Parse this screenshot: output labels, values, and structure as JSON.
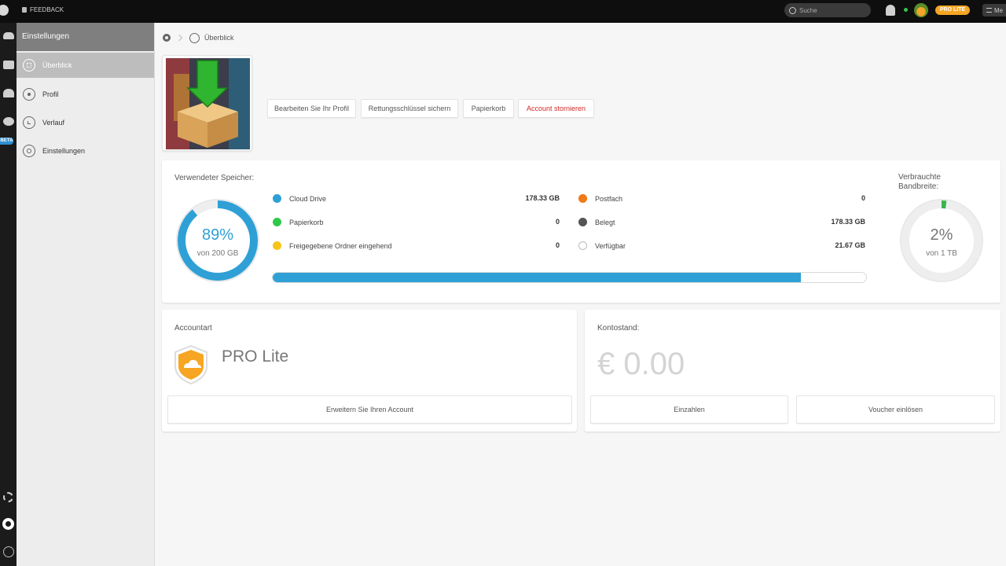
{
  "topbar": {
    "feedback_label": "FEEDBACK",
    "search_placeholder": "Suche",
    "plan_badge": "PRO LITE",
    "menu_label": "Me"
  },
  "rail": {
    "beta_badge": "BETA"
  },
  "sidebar": {
    "header": "Einstellungen",
    "items": [
      {
        "label": "Überblick",
        "icon": "grid-icon",
        "active": true
      },
      {
        "label": "Profil",
        "icon": "user-icon"
      },
      {
        "label": "Verlauf",
        "icon": "clock-icon"
      },
      {
        "label": "Einstellungen",
        "icon": "gear-icon"
      }
    ]
  },
  "breadcrumb": {
    "current": "Überblick"
  },
  "profile_actions": {
    "edit": "Bearbeiten Sie Ihr Profil",
    "backup_key": "Rettungsschlüssel sichern",
    "trash": "Papierkorb",
    "cancel_account": "Account stornieren"
  },
  "storage": {
    "title": "Verwendeter Speicher:",
    "percent_label": "89%",
    "percent_value": 89,
    "of_label": "von 200 GB",
    "bar_fill": 0.89,
    "legend": [
      {
        "label": "Cloud Drive",
        "value": "178.33 GB",
        "color": "#2ea0d6"
      },
      {
        "label": "Papierkorb",
        "value": "0",
        "color": "#2fc94a"
      },
      {
        "label": "Freigegebene Ordner eingehend",
        "value": "0",
        "color": "#f5c518"
      },
      {
        "label": "Postfach",
        "value": "0",
        "color": "#f07a16"
      },
      {
        "label": "Belegt",
        "value": "178.33 GB",
        "color": "#555555"
      },
      {
        "label": "Verfügbar",
        "value": "21.67 GB",
        "color": "#ffffff"
      }
    ]
  },
  "bandwidth": {
    "title_line1": "Verbrauchte",
    "title_line2": "Bandbreite:",
    "percent_label": "2%",
    "percent_value": 2,
    "of_label": "von 1 TB",
    "color": "#39b54a"
  },
  "account": {
    "title": "Accountart",
    "plan_name": "PRO Lite",
    "upgrade_button": "Erweitern Sie Ihren Account",
    "badge_color": "#f6a623"
  },
  "balance": {
    "title": "Kontostand:",
    "amount": "€ 0.00",
    "deposit_button": "Einzahlen",
    "voucher_button": "Voucher einlösen"
  }
}
